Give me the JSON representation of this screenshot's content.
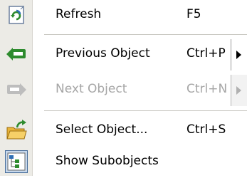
{
  "menu": {
    "items": [
      {
        "icon": "refresh-icon",
        "label": "Refresh",
        "shortcut": "F5",
        "enabled": true
      },
      {
        "icon": "previous-object-icon",
        "label": "Previous Object",
        "shortcut": "Ctrl+P",
        "enabled": true,
        "submenu": true
      },
      {
        "icon": "next-object-icon",
        "label": "Next Object",
        "shortcut": "Ctrl+N",
        "enabled": false,
        "submenu": true
      },
      {
        "icon": "select-object-icon",
        "label": "Select Object...",
        "shortcut": "Ctrl+S",
        "enabled": true
      },
      {
        "icon": "show-subobjects-icon",
        "label": "Show Subobjects",
        "shortcut": "",
        "enabled": true
      }
    ]
  },
  "colors": {
    "gutter": "#ecebe6",
    "text": "#000000",
    "disabled_text": "#a6a6a6",
    "icon_green": "#2e8b2e",
    "icon_blue": "#2f6fb5"
  }
}
